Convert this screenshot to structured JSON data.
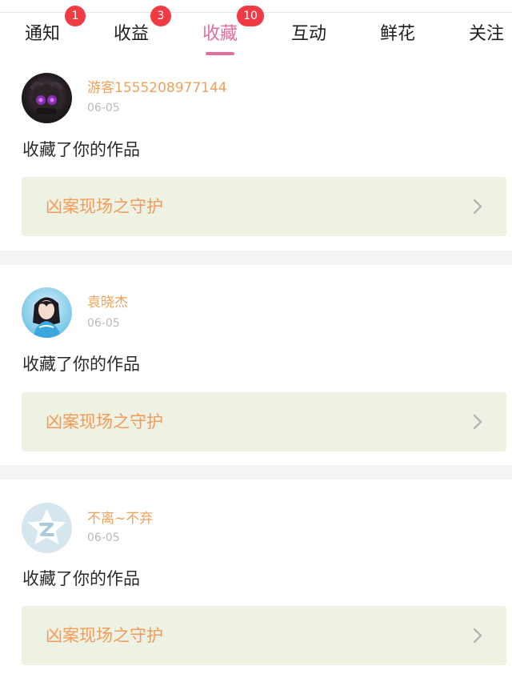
{
  "tabs": [
    {
      "label": "通知",
      "badge": "1"
    },
    {
      "label": "收益",
      "badge": "3"
    },
    {
      "label": "收藏",
      "badge": "10"
    },
    {
      "label": "互动",
      "badge": ""
    },
    {
      "label": "鲜花",
      "badge": ""
    },
    {
      "label": "关注",
      "badge": ""
    }
  ],
  "active_tab": "收藏",
  "colors": {
    "accent": "#e36d9c",
    "badge": "#ef3b44",
    "username": "#f0a15c",
    "work_title": "#f29a5a",
    "work_bg": "#eef2e3"
  },
  "items": [
    {
      "username": "游客1555208977144",
      "date": "06-05",
      "action": "收藏了你的作品",
      "work_title": "凶案现场之守护",
      "avatar_icon": "dark-creature-avatar"
    },
    {
      "username": "袁晓杰",
      "date": "06-05",
      "action": "收藏了你的作品",
      "work_title": "凶案现场之守护",
      "avatar_icon": "girl-portrait-avatar"
    },
    {
      "username": "不离~不弃",
      "date": "06-05",
      "action": "收藏了你的作品",
      "work_title": "凶案现场之守护",
      "avatar_icon": "default-star-avatar"
    }
  ]
}
